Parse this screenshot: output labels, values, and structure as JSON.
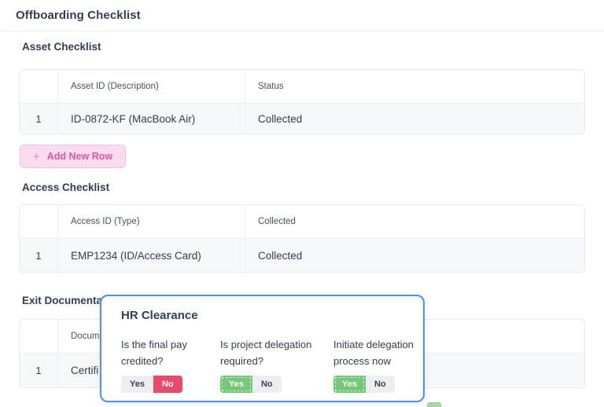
{
  "page": {
    "title": "Offboarding Checklist"
  },
  "sections": {
    "asset": {
      "heading": "Asset Checklist",
      "columns": {
        "c1": "Asset ID (Description)",
        "c2": "Status"
      },
      "row": {
        "num": "1",
        "c1": "ID-0872-KF (MacBook Air)",
        "c2": "Collected"
      },
      "add_row_label": "Add New Row",
      "add_row_icon": "+"
    },
    "access": {
      "heading": "Access Checklist",
      "columns": {
        "c1": "Access ID (Type)",
        "c2": "Collected"
      },
      "row": {
        "num": "1",
        "c1": "EMP1234 (ID/Access Card)",
        "c2": "Collected"
      }
    },
    "exit": {
      "heading": "Exit Documenta",
      "columns": {
        "c1": "Docume",
        "c2": ""
      },
      "row": {
        "num": "1",
        "c1": "Certifi",
        "c2": ""
      }
    }
  },
  "modal": {
    "title": "HR Clearance",
    "questions": [
      {
        "label": "Is the final pay credited?",
        "yes_label": "Yes",
        "no_label": "No",
        "selected": "no"
      },
      {
        "label": "Is project delegation required?",
        "yes_label": "Yes",
        "no_label": "No",
        "selected": "yes"
      },
      {
        "label": "Initiate delegation process now",
        "yes_label": "Yes",
        "no_label": "No",
        "selected": "yes"
      }
    ]
  },
  "colors": {
    "accent_pink": "#e0569f",
    "pink_button_bg": "#fadcee",
    "modal_border_blue": "#4a90f5",
    "toggle_red": "#e84a6e",
    "toggle_green": "#74c877",
    "heading_text": "#333e52",
    "row_bg": "#f7f8f9"
  }
}
